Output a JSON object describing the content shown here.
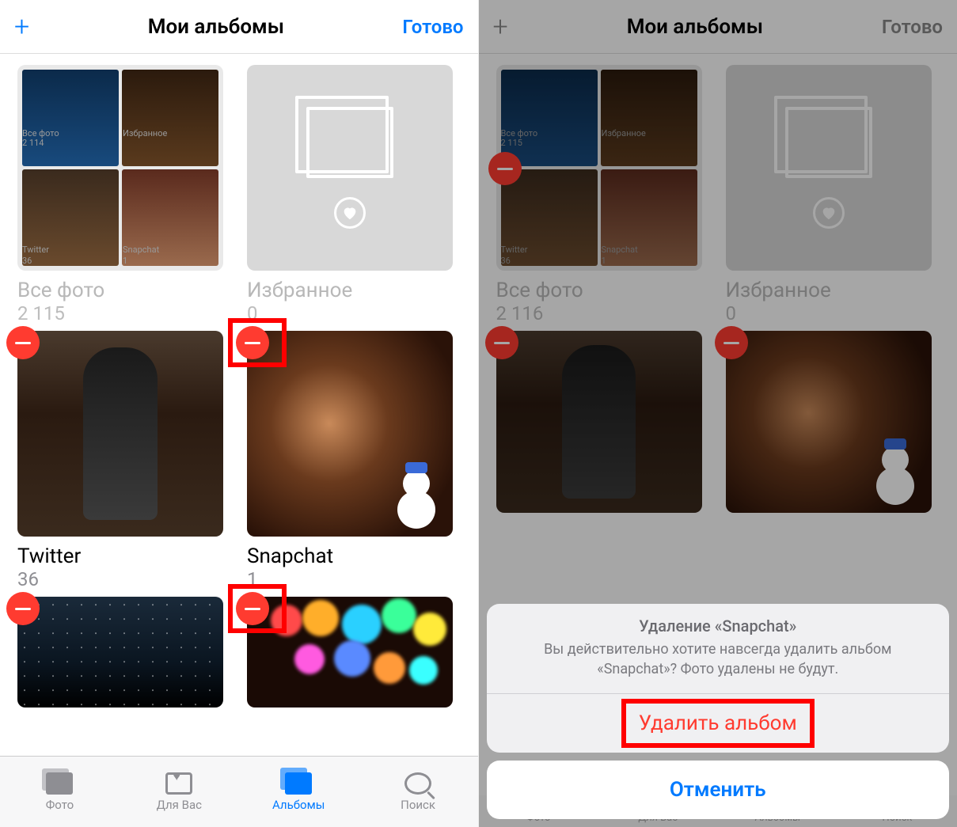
{
  "left": {
    "nav": {
      "title": "Мои альбомы",
      "done": "Готово"
    },
    "top_albums": [
      {
        "title": "Все фото",
        "count": "2 115",
        "mini": {
          "a": "Все фото",
          "a_count": "2 114",
          "b": "Избранное",
          "c": "Twitter",
          "c_count": "36",
          "d": "Snapchat",
          "d_count": "1"
        }
      },
      {
        "title": "Избранное",
        "count": "0"
      }
    ],
    "user_albums": [
      {
        "title": "Twitter",
        "count": "36"
      },
      {
        "title": "Snapchat",
        "count": "1"
      }
    ],
    "tabs": {
      "photos": "Фото",
      "foryou": "Для Вас",
      "albums": "Альбомы",
      "search": "Поиск"
    }
  },
  "right": {
    "nav": {
      "title": "Мои альбомы",
      "done": "Готово"
    },
    "top_albums": [
      {
        "title": "Все фото",
        "count": "2 116",
        "mini": {
          "a": "Все фото",
          "a_count": "2 115",
          "b": "Избранное",
          "c": "Twitter",
          "c_count": "36",
          "d": "Snapchat",
          "d_count": "1"
        }
      },
      {
        "title": "Избранное",
        "count": "0"
      }
    ],
    "sheet": {
      "title": "Удаление «Snapchat»",
      "message": "Вы действительно хотите навсегда удалить альбом «Snapchat»? Фото удалены не будут.",
      "delete": "Удалить альбом",
      "cancel": "Отменить"
    },
    "tabs": {
      "photos": "Фото",
      "foryou": "Для Вас",
      "albums": "Альбомы",
      "search": "Поиск"
    }
  }
}
